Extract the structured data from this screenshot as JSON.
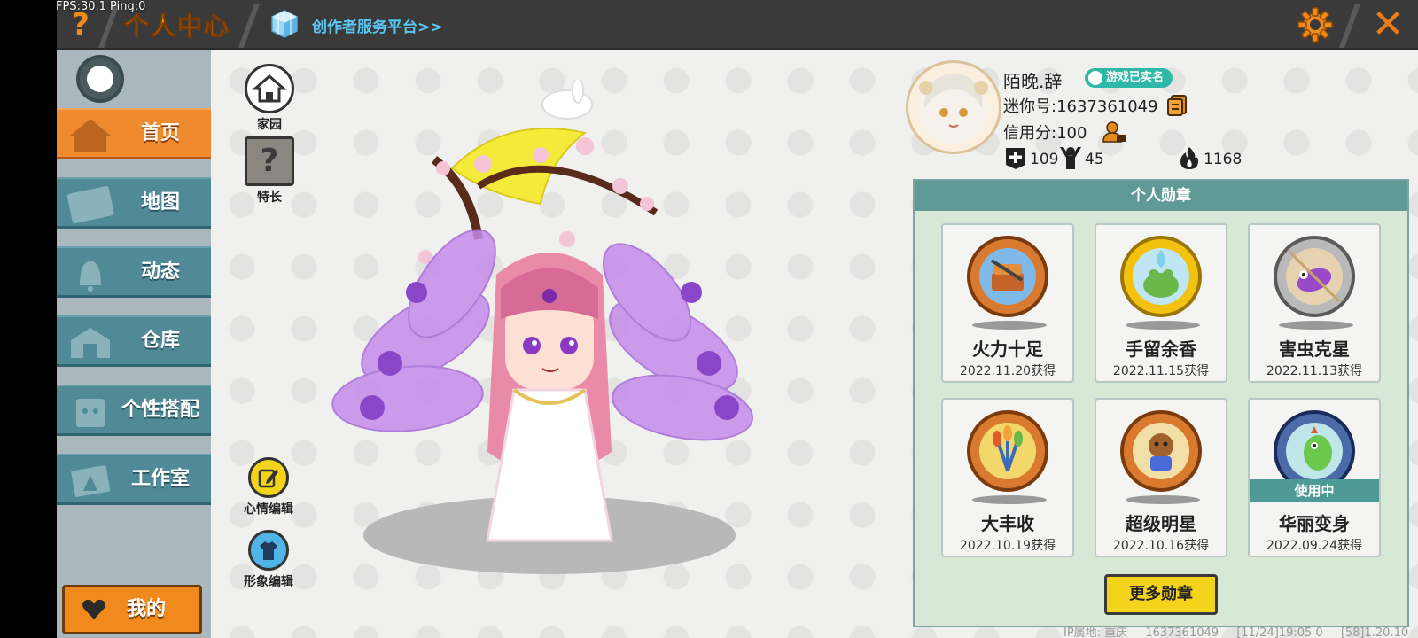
{
  "status_bar": {
    "fps_text": "FPS:30.1",
    "ping_text": "Ping:0"
  },
  "header": {
    "help_symbol": "?",
    "title": "个人中心",
    "creator_link": "创作者服务平台>>",
    "close_symbol": "✕"
  },
  "sidebar": {
    "items": [
      {
        "label": "首页",
        "icon": "home-icon",
        "active": true
      },
      {
        "label": "地图",
        "icon": "map-icon",
        "active": false
      },
      {
        "label": "动态",
        "icon": "bell-icon",
        "active": false
      },
      {
        "label": "仓库",
        "icon": "warehouse-icon",
        "active": false
      },
      {
        "label": "个性搭配",
        "icon": "outfit-icon",
        "active": false
      },
      {
        "label": "工作室",
        "icon": "studio-icon",
        "active": false
      }
    ],
    "mine_label": "我的"
  },
  "tools": {
    "homestead_label": "家园",
    "specialty_label": "特长",
    "specialty_symbol": "?",
    "mood_edit_label": "心情编辑",
    "avatar_edit_label": "形象编辑"
  },
  "profile": {
    "nickname": "陌晚.辞",
    "realname_badge": "游戏已实名",
    "mini_id": "迷你号:1637361049",
    "credit": "信用分:100",
    "stats": [
      {
        "icon": "plus-box-icon",
        "value": "109"
      },
      {
        "icon": "cheer-icon",
        "value": "45"
      },
      {
        "icon": "flame-icon",
        "value": "1168"
      }
    ]
  },
  "medals": {
    "header": "个人勋章",
    "items": [
      {
        "name": "火力十足",
        "date": "2022.11.20获得",
        "icon": "treasure-medal-icon",
        "in_use": false
      },
      {
        "name": "手留余香",
        "date": "2022.11.15获得",
        "icon": "frog-medal-icon",
        "in_use": false
      },
      {
        "name": "害虫克星",
        "date": "2022.11.13获得",
        "icon": "bug-medal-icon",
        "in_use": false
      },
      {
        "name": "大丰收",
        "date": "2022.10.19获得",
        "icon": "harvest-medal-icon",
        "in_use": false
      },
      {
        "name": "超级明星",
        "date": "2022.10.16获得",
        "icon": "star-medal-icon",
        "in_use": false
      },
      {
        "name": "华丽变身",
        "date": "2022.09.24获得",
        "icon": "dino-medal-icon",
        "in_use": true
      }
    ],
    "in_use_label": "使用中",
    "more_label": "更多勋章"
  },
  "footer": {
    "ip_location": "IP属地: 重庆",
    "uid": "1637361049",
    "time": "[11/24]19:05 0",
    "version": "[58]1.20.10"
  },
  "colors": {
    "accent_orange": "#f08a2e",
    "nav_teal": "#4f8a96",
    "medal_header": "#5f9a96",
    "button_yellow": "#f3d41a"
  }
}
